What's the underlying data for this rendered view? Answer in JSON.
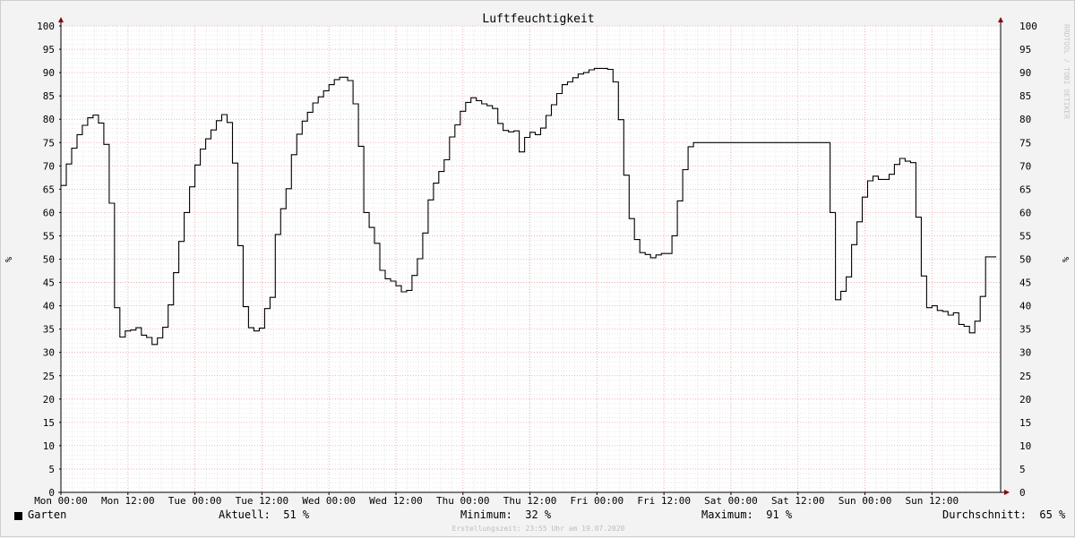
{
  "chart_data": {
    "type": "line",
    "title": "Luftfeuchtigkeit",
    "ylabel": "%",
    "ylim": [
      0,
      100
    ],
    "yticks": [
      0,
      5,
      10,
      15,
      20,
      25,
      30,
      35,
      40,
      45,
      50,
      55,
      60,
      65,
      70,
      75,
      80,
      85,
      90,
      95,
      100
    ],
    "xlim": [
      0,
      168.3
    ],
    "xticks": [
      {
        "x": 0,
        "label": "Mon 00:00"
      },
      {
        "x": 12,
        "label": "Mon 12:00"
      },
      {
        "x": 24,
        "label": "Tue 00:00"
      },
      {
        "x": 36,
        "label": "Tue 12:00"
      },
      {
        "x": 48,
        "label": "Wed 00:00"
      },
      {
        "x": 60,
        "label": "Wed 12:00"
      },
      {
        "x": 72,
        "label": "Thu 00:00"
      },
      {
        "x": 84,
        "label": "Thu 12:00"
      },
      {
        "x": 96,
        "label": "Fri 00:00"
      },
      {
        "x": 108,
        "label": "Fri 12:00"
      },
      {
        "x": 120,
        "label": "Sat 00:00"
      },
      {
        "x": 132,
        "label": "Sat 12:00"
      },
      {
        "x": 144,
        "label": "Sun 00:00"
      },
      {
        "x": 156,
        "label": "Sun 12:00"
      }
    ],
    "grid": true,
    "step": true,
    "series": [
      {
        "name": "Garten",
        "color": "#000000",
        "points": [
          [
            0,
            65.8
          ],
          [
            0.96,
            70.4
          ],
          [
            1.92,
            73.8
          ],
          [
            2.88,
            76.7
          ],
          [
            3.84,
            78.7
          ],
          [
            4.8,
            80.3
          ],
          [
            5.76,
            80.9
          ],
          [
            6.72,
            79.2
          ],
          [
            7.68,
            74.6
          ],
          [
            8.64,
            62
          ],
          [
            9.6,
            39.6
          ],
          [
            10.56,
            33.3
          ],
          [
            11.52,
            34.6
          ],
          [
            12.48,
            34.8
          ],
          [
            13.44,
            35.3
          ],
          [
            14.4,
            33.7
          ],
          [
            15.36,
            33.2
          ],
          [
            16.32,
            31.7
          ],
          [
            17.28,
            33.1
          ],
          [
            18.24,
            35.4
          ],
          [
            19.2,
            40.2
          ],
          [
            20.16,
            47.1
          ],
          [
            21.12,
            53.8
          ],
          [
            22.08,
            60
          ],
          [
            23.04,
            65.5
          ],
          [
            24,
            70.2
          ],
          [
            24.96,
            73.6
          ],
          [
            25.92,
            75.8
          ],
          [
            26.88,
            77.7
          ],
          [
            27.84,
            79.7
          ],
          [
            28.8,
            81
          ],
          [
            29.76,
            79.3
          ],
          [
            30.72,
            70.6
          ],
          [
            31.68,
            52.9
          ],
          [
            32.64,
            39.8
          ],
          [
            33.6,
            35.3
          ],
          [
            34.56,
            34.6
          ],
          [
            35.52,
            35.2
          ],
          [
            36.48,
            39.4
          ],
          [
            37.44,
            41.8
          ],
          [
            38.4,
            55.3
          ],
          [
            39.36,
            60.8
          ],
          [
            40.32,
            65.1
          ],
          [
            41.28,
            72.4
          ],
          [
            42.24,
            76.8
          ],
          [
            43.2,
            79.6
          ],
          [
            44.16,
            81.5
          ],
          [
            45.12,
            83.5
          ],
          [
            46.08,
            84.8
          ],
          [
            47.04,
            86.1
          ],
          [
            48,
            87.4
          ],
          [
            48.96,
            88.5
          ],
          [
            49.92,
            89
          ],
          [
            51.36,
            88.3
          ],
          [
            52.32,
            83.3
          ],
          [
            53.28,
            74.2
          ],
          [
            54.24,
            60
          ],
          [
            55.2,
            56.8
          ],
          [
            56.16,
            53.4
          ],
          [
            57.12,
            47.6
          ],
          [
            58.08,
            45.8
          ],
          [
            59.04,
            45.3
          ],
          [
            60,
            44.3
          ],
          [
            60.96,
            43
          ],
          [
            61.92,
            43.3
          ],
          [
            62.88,
            46.5
          ],
          [
            63.84,
            50.1
          ],
          [
            64.8,
            55.6
          ],
          [
            65.76,
            62.7
          ],
          [
            66.72,
            66.3
          ],
          [
            67.68,
            68.8
          ],
          [
            68.64,
            71.3
          ],
          [
            69.6,
            76.2
          ],
          [
            70.56,
            78.8
          ],
          [
            71.52,
            81.7
          ],
          [
            72.48,
            83.6
          ],
          [
            73.44,
            84.6
          ],
          [
            74.4,
            84
          ],
          [
            75.36,
            83.3
          ],
          [
            76.32,
            82.9
          ],
          [
            77.28,
            82.3
          ],
          [
            78.24,
            79.1
          ],
          [
            79.2,
            77.6
          ],
          [
            80.16,
            77.3
          ],
          [
            81.12,
            77.5
          ],
          [
            82.08,
            73
          ],
          [
            83.04,
            76.1
          ],
          [
            84,
            77.2
          ],
          [
            84.96,
            76.7
          ],
          [
            85.92,
            78.1
          ],
          [
            86.88,
            80.8
          ],
          [
            87.84,
            83.1
          ],
          [
            88.8,
            85.5
          ],
          [
            89.76,
            87.4
          ],
          [
            90.72,
            88
          ],
          [
            91.68,
            88.9
          ],
          [
            92.64,
            89.7
          ],
          [
            93.6,
            90
          ],
          [
            94.56,
            90.6
          ],
          [
            95.52,
            90.9
          ],
          [
            97.92,
            90.7
          ],
          [
            98.88,
            88
          ],
          [
            99.84,
            79.9
          ],
          [
            100.8,
            68
          ],
          [
            101.76,
            58.7
          ],
          [
            102.72,
            54.2
          ],
          [
            103.68,
            51.4
          ],
          [
            104.64,
            51
          ],
          [
            105.6,
            50.3
          ],
          [
            106.56,
            50.9
          ],
          [
            107.52,
            51.2
          ],
          [
            109.44,
            55
          ],
          [
            110.4,
            62.5
          ],
          [
            111.36,
            69.2
          ],
          [
            112.32,
            74.1
          ],
          [
            113.28,
            75
          ],
          [
            136.8,
            75
          ],
          [
            137.76,
            60
          ],
          [
            138.72,
            41.3
          ],
          [
            139.68,
            43.1
          ],
          [
            140.64,
            46.2
          ],
          [
            141.6,
            53.1
          ],
          [
            142.56,
            58
          ],
          [
            143.52,
            63.3
          ],
          [
            144.48,
            66.8
          ],
          [
            145.44,
            67.8
          ],
          [
            146.4,
            67.1
          ],
          [
            148.32,
            68.2
          ],
          [
            149.28,
            70.3
          ],
          [
            150.24,
            71.6
          ],
          [
            151.2,
            71
          ],
          [
            152.16,
            70.7
          ],
          [
            153.12,
            59
          ],
          [
            154.08,
            46.4
          ],
          [
            155.04,
            39.6
          ],
          [
            156,
            40
          ],
          [
            156.96,
            39
          ],
          [
            157.92,
            38.8
          ],
          [
            158.88,
            38
          ],
          [
            159.84,
            38.5
          ],
          [
            160.8,
            36
          ],
          [
            161.76,
            35.6
          ],
          [
            162.72,
            34.2
          ],
          [
            163.68,
            36.7
          ],
          [
            164.64,
            42
          ],
          [
            165.6,
            50.5
          ],
          [
            166.56,
            50.5
          ]
        ]
      }
    ]
  },
  "legend": {
    "series_label": "Garten",
    "current_label": "Aktuell:",
    "current_value": "51 %",
    "min_label": "Minimum:",
    "min_value": "32 %",
    "max_label": "Maximum:",
    "max_value": "91 %",
    "avg_label": "Durchschnitt:",
    "avg_value": "65 %"
  },
  "footer": "Erstellungszeit: 23:55 Uhr am 19.07.2020",
  "watermark": "RRDTOOL / TOBI OETIKER",
  "colors": {
    "background": "#f3f3f3",
    "canvas": "#ffffff",
    "line": "#000000",
    "major_grid": "#e8a0a0",
    "minor_grid": "#dddddd",
    "axis": "#000000",
    "arrow": "#8b0000"
  }
}
